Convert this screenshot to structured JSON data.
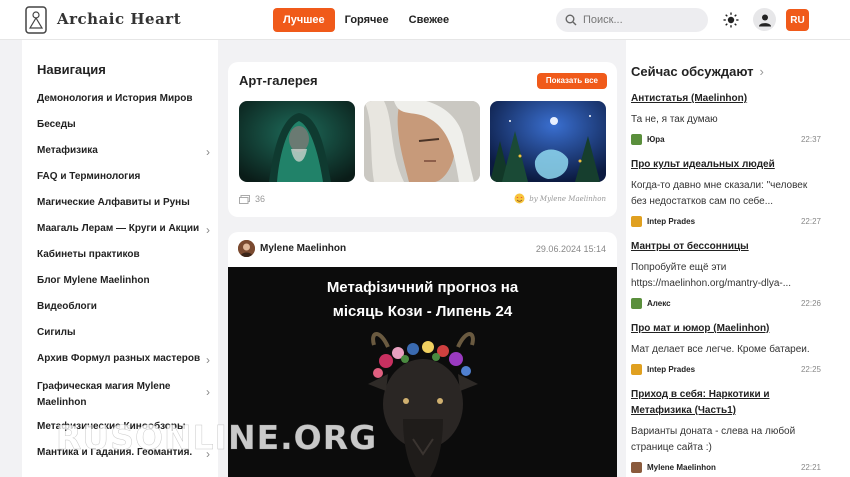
{
  "header": {
    "brand": "Archaic Heart",
    "tabs": [
      {
        "label": "Лучшее",
        "active": true
      },
      {
        "label": "Горячее",
        "active": false
      },
      {
        "label": "Свежее",
        "active": false
      }
    ],
    "search_placeholder": "Поиск...",
    "lang": "RU",
    "accent": "#f05a1a"
  },
  "sidebar": {
    "title": "Навигация",
    "items": [
      {
        "label": "Демонология и История Миров",
        "has_children": false
      },
      {
        "label": "Беседы",
        "has_children": false
      },
      {
        "label": "Метафизика",
        "has_children": true
      },
      {
        "label": "FAQ и Терминология",
        "has_children": false
      },
      {
        "label": "Магические Алфавиты и Руны",
        "has_children": false
      },
      {
        "label": "Маагаль Лерам — Круги и Акции",
        "has_children": true
      },
      {
        "label": "Кабинеты практиков",
        "has_children": false
      },
      {
        "label": "Блог Mylene Maelinhon",
        "has_children": false
      },
      {
        "label": "Видеоблоги",
        "has_children": false
      },
      {
        "label": "Сигилы",
        "has_children": false
      },
      {
        "label": "Архив Формул разных мастеров",
        "has_children": true
      },
      {
        "label": "Графическая магия Mylene Maelinhon",
        "has_children": true
      },
      {
        "label": "Метафизические Кинообзоры",
        "has_children": false
      },
      {
        "label": "Мантика и Гадания. Геомантия.",
        "has_children": true
      }
    ]
  },
  "gallery": {
    "title": "Арт-галерея",
    "show_all": "Показать все",
    "count": "36",
    "signature": "by Mylene Maelinhon"
  },
  "post": {
    "author": "Mylene Maelinhon",
    "date": "29.06.2024 15:14",
    "headline_line1": "Метафізичний прогноз на",
    "headline_line2": "місяць Кози - Липень 24"
  },
  "discussions": {
    "title": "Сейчас обсуждают",
    "items": [
      {
        "title": "Антистатья (Maelinhon)",
        "text": "Та не, я так думаю",
        "user": "Юра",
        "time": "22:37",
        "avatar_color": "#5a8f3c"
      },
      {
        "title": "Про культ идеальных людей",
        "text": "Когда-то давно мне сказали: \"человек без недостатков сам по себе...",
        "user": "Intep Prades",
        "time": "22:27",
        "avatar_color": "#e0a020"
      },
      {
        "title": "Мантры от бессонницы",
        "text": "Попробуйте ещё эти https://maelinhon.org/mantry-dlya-...",
        "user": "Алекс",
        "time": "22:26",
        "avatar_color": "#5a8f3c"
      },
      {
        "title": "Про мат и юмор (Maelinhon)",
        "text": "Мат делает все легче. Кроме батареи.",
        "user": "Intep Prades",
        "time": "22:25",
        "avatar_color": "#e0a020"
      },
      {
        "title": "Приход в себя: Наркотики и Метафизика (Часть1)",
        "text": "Варианты доната - слева на любой странице сайта :)",
        "user": "Mylene Maelinhon",
        "time": "22:21",
        "avatar_color": "#8a5a3c"
      }
    ]
  },
  "watermark": "RUSONLINE.ORG"
}
